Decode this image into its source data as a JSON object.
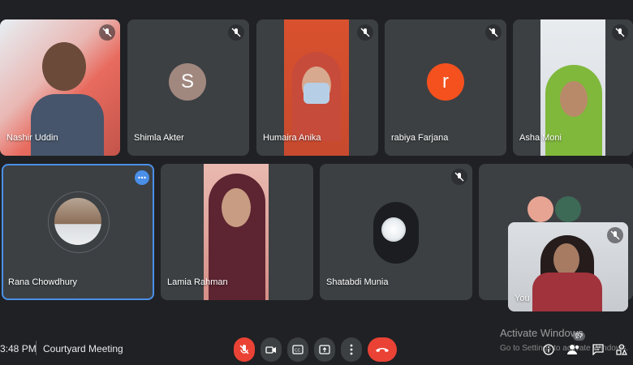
{
  "participants": [
    {
      "name": "Nashir Uddin",
      "muted": true
    },
    {
      "name": "Shimla Akter",
      "muted": true,
      "initial": "S",
      "avatar_color": "#a1887f"
    },
    {
      "name": "Humaira Anika",
      "muted": true
    },
    {
      "name": "rabiya Farjana",
      "muted": true,
      "initial": "r",
      "avatar_color": "#f4511e"
    },
    {
      "name": "Asha Moni",
      "muted": true
    },
    {
      "name": "Rana Chowdhury",
      "muted": false
    },
    {
      "name": "Lamia Rahman",
      "muted": false
    },
    {
      "name": "Shatabdi Munia",
      "muted": true
    }
  ],
  "self_view": {
    "label": "You",
    "muted": true
  },
  "bottom": {
    "time": "3:48 PM",
    "meeting_name": "Courtyard Meeting",
    "participant_count": "27"
  },
  "watermark": {
    "line1": "Activate Windows",
    "line2": "Go to Settings to activate Windows."
  },
  "colors": {
    "background": "#202124",
    "tile": "#3c4043",
    "accent": "#4a8fe8",
    "danger": "#ea4335"
  }
}
